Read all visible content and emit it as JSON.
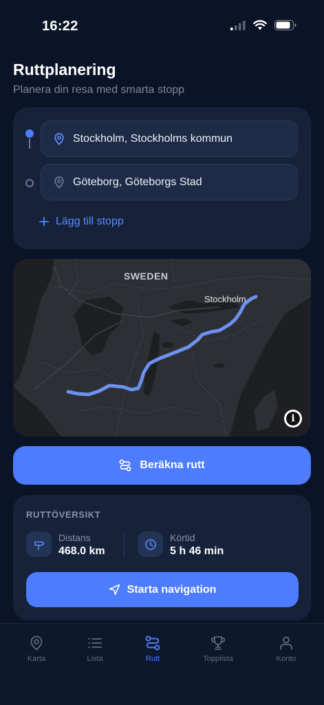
{
  "status": {
    "time": "16:22"
  },
  "header": {
    "title": "Ruttplanering",
    "subtitle": "Planera din resa med smarta stopp"
  },
  "route": {
    "start": "Stockholm,  Stockholms kommun",
    "destination": "Göteborg,  Göteborgs Stad",
    "add_stop": "Lägg till stopp"
  },
  "map": {
    "country_label": "SWEDEN",
    "city_label": "Stockholm",
    "info_label": "i"
  },
  "calculate_label": "Beräkna rutt",
  "overview": {
    "heading": "RUTTÖVERSIKT",
    "distance_label": "Distans",
    "distance_value": "468.0 km",
    "time_label": "Körtid",
    "time_value": "5 h 46 min",
    "start_nav_label": "Starta navigation"
  },
  "tabs": [
    {
      "label": "Karta"
    },
    {
      "label": "Lista"
    },
    {
      "label": "Rutt"
    },
    {
      "label": "Topplista"
    },
    {
      "label": "Konto"
    }
  ],
  "colors": {
    "accent": "#4d7cfe",
    "background": "#0b1426",
    "card": "#15223a",
    "route_line": "#6e90f0"
  }
}
